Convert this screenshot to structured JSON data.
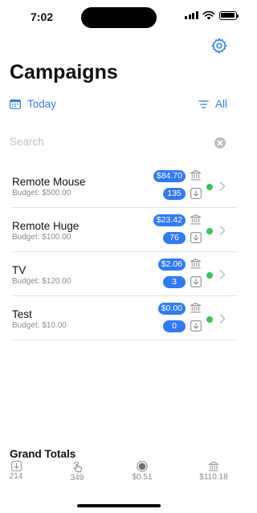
{
  "status_bar": {
    "time": "7:02"
  },
  "header": {
    "title": "Campaigns"
  },
  "filters": {
    "date_label": "Today",
    "type_label": "All"
  },
  "search": {
    "placeholder": "Search"
  },
  "campaigns": [
    {
      "name": "Remote Mouse",
      "budget": "Budget: $500.00",
      "spend": "$84.70",
      "count": "135",
      "status": "active"
    },
    {
      "name": "Remote Huge",
      "budget": "Budget: $100.00",
      "spend": "$23.42",
      "count": "76",
      "status": "active"
    },
    {
      "name": "TV",
      "budget": "Budget: $120.00",
      "spend": "$2.06",
      "count": "3",
      "status": "active"
    },
    {
      "name": "Test",
      "budget": "Budget: $10.00",
      "spend": "$0.00",
      "count": "0",
      "status": "active"
    }
  ],
  "grand_totals": {
    "title": "Grand Totals",
    "downloads": "214",
    "taps": "349",
    "impressions_cost": "$0.51",
    "spend": "$110.18"
  },
  "colors": {
    "accent": "#2f7bf6",
    "active": "#34c759",
    "secondary_text": "#8b8b90"
  },
  "icons": {
    "settings": "gear-icon",
    "calendar": "calendar-icon",
    "filter": "filter-lines-icon",
    "clear": "clear-circle-icon",
    "bank": "bank-icon",
    "download": "download-box-icon",
    "chevron": "chevron-right-icon",
    "tap": "tap-hand-icon",
    "impressions": "record-circle-icon"
  }
}
